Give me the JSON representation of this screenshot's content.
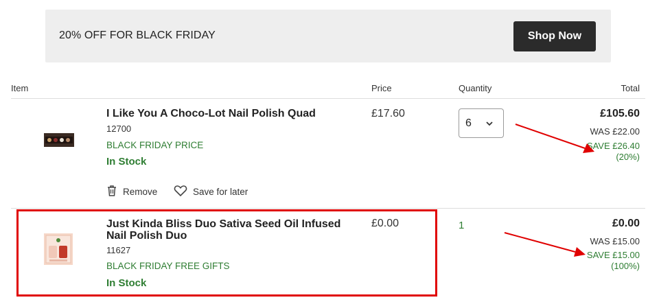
{
  "banner": {
    "text": "20% OFF FOR BLACK FRIDAY",
    "button_label": "Shop Now"
  },
  "table": {
    "headers": {
      "item": "Item",
      "price": "Price",
      "quantity": "Quantity",
      "total": "Total"
    }
  },
  "items": [
    {
      "title": "I Like You A Choco-Lot Nail Polish Quad",
      "sku": "12700",
      "promo": "BLACK FRIDAY PRICE",
      "stock": "In Stock",
      "price": "£17.60",
      "quantity": "6",
      "total": "£105.60",
      "was": "WAS £22.00",
      "save": "SAVE £26.40",
      "save_pct": "(20%)",
      "remove_label": "Remove",
      "save_later_label": "Save for later"
    },
    {
      "title": "Just Kinda Bliss Duo Sativa Seed Oil Infused Nail Polish Duo",
      "sku": "11627",
      "promo": "BLACK FRIDAY FREE GIFTS",
      "stock": "In Stock",
      "price": "£0.00",
      "quantity": "1",
      "total": "£0.00",
      "was": "WAS £15.00",
      "save": "SAVE £15.00",
      "save_pct": "(100%)"
    }
  ],
  "colors": {
    "accent_green": "#2e7d32",
    "annotation_red": "#e00000",
    "button_dark": "#2b2b2b",
    "banner_bg": "#eeeeee"
  },
  "icons": [
    "trash-icon",
    "heart-icon",
    "chevron-down-icon"
  ]
}
